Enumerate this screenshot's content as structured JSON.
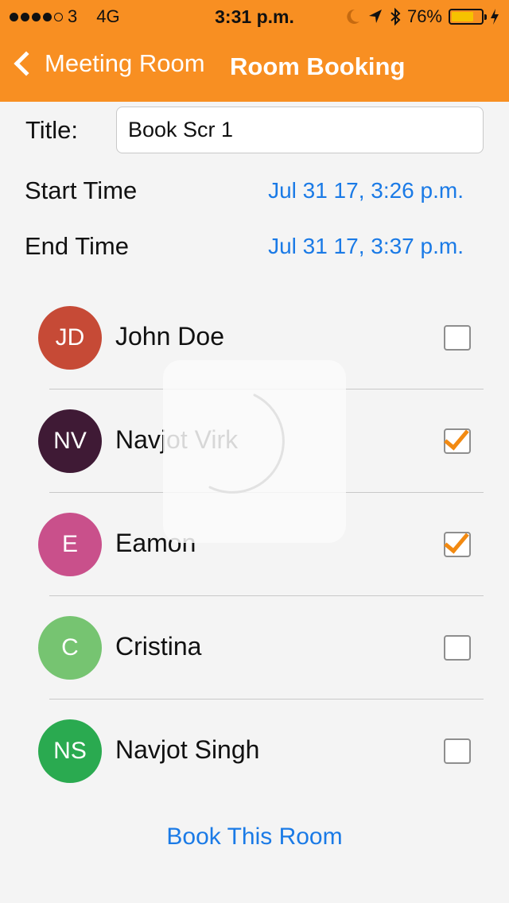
{
  "status_bar": {
    "carrier": "3",
    "network": "4G",
    "time": "3:31 p.m.",
    "battery": "76%",
    "battery_level": 0.76,
    "icons": [
      "signal-dots-icon",
      "moon-icon",
      "location-arrow-icon",
      "bluetooth-icon",
      "battery-icon",
      "charging-bolt-icon"
    ]
  },
  "nav": {
    "back_label": "Meeting Room",
    "title": "Room Booking",
    "color": "#f88f22"
  },
  "form": {
    "title_label": "Title:",
    "title_value": "Book Scr 1",
    "start_label": "Start Time",
    "start_value": "Jul 31 17, 3:26 p.m.",
    "end_label": "End Time",
    "end_value": "Jul 31 17, 3:37 p.m."
  },
  "attendees": [
    {
      "initials": "JD",
      "name": "John Doe",
      "color": "#c64a36",
      "checked": false
    },
    {
      "initials": "NV",
      "name": "Navjot Virk",
      "color": "#3f1a35",
      "checked": true
    },
    {
      "initials": "E",
      "name": "Eamon",
      "color": "#c9508b",
      "checked": true
    },
    {
      "initials": "C",
      "name": "Cristina",
      "color": "#76c471",
      "checked": false
    },
    {
      "initials": "NS",
      "name": "Navjot Singh",
      "color": "#2aaa50",
      "checked": false
    }
  ],
  "book_button": "Book This Room",
  "accent_color": "#1a7ae6",
  "check_color": "#f28a12"
}
